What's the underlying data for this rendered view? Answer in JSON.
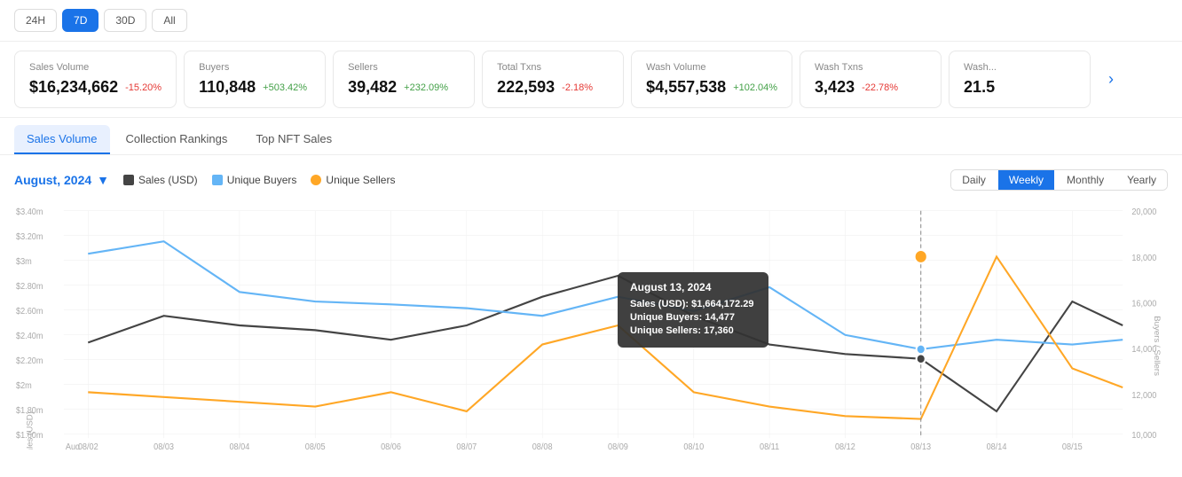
{
  "topBar": {
    "buttons": [
      {
        "label": "24H",
        "active": false
      },
      {
        "label": "7D",
        "active": true
      },
      {
        "label": "30D",
        "active": false
      },
      {
        "label": "All",
        "active": false
      }
    ]
  },
  "metrics": [
    {
      "label": "Sales Volume",
      "value": "$16,234,662",
      "change": "-15.20%",
      "changeType": "negative"
    },
    {
      "label": "Buyers",
      "value": "110,848",
      "change": "+503.42%",
      "changeType": "positive"
    },
    {
      "label": "Sellers",
      "value": "39,482",
      "change": "+232.09%",
      "changeType": "positive"
    },
    {
      "label": "Total Txns",
      "value": "222,593",
      "change": "-2.18%",
      "changeType": "negative"
    },
    {
      "label": "Wash Volume",
      "value": "$4,557,538",
      "change": "+102.04%",
      "changeType": "positive"
    },
    {
      "label": "Wash Txns",
      "value": "3,423",
      "change": "-22.78%",
      "changeType": "negative"
    },
    {
      "label": "Wash...",
      "value": "21.5",
      "change": "",
      "changeType": ""
    }
  ],
  "tabs": [
    {
      "label": "Sales Volume",
      "active": true
    },
    {
      "label": "Collection Rankings",
      "active": false
    },
    {
      "label": "Top NFT Sales",
      "active": false
    }
  ],
  "chart": {
    "monthLabel": "August, 2024",
    "legend": [
      {
        "label": "Sales (USD)",
        "color": "#444"
      },
      {
        "label": "Unique Buyers",
        "color": "#64b5f6"
      },
      {
        "label": "Unique Sellers",
        "color": "#ffa726"
      }
    ],
    "periodButtons": [
      {
        "label": "Daily",
        "active": false
      },
      {
        "label": "Weekly",
        "active": true
      },
      {
        "label": "Monthly",
        "active": false
      },
      {
        "label": "Yearly",
        "active": false
      }
    ],
    "xLabels": [
      "Aug",
      "08/02",
      "08/03",
      "08/04",
      "08/05",
      "08/06",
      "08/07",
      "08/08",
      "08/09",
      "08/10",
      "08/11",
      "08/12",
      "08/13",
      "08/14",
      "08/15"
    ],
    "yLeft": [
      "$3.40m",
      "$3.20m",
      "$3m",
      "$2.80m",
      "$2.60m",
      "$2.40m",
      "$2.20m",
      "$2m",
      "$1.80m",
      "$1.60m"
    ],
    "yRight": [
      "20,000",
      "18,000",
      "16,000",
      "14,000",
      "12,000",
      "10,000"
    ],
    "tooltip": {
      "title": "August 13, 2024",
      "rows": [
        {
          "label": "Sales (USD):",
          "value": "$1,664,172.29"
        },
        {
          "label": "Unique Buyers:",
          "value": "14,477"
        },
        {
          "label": "Unique Sellers:",
          "value": "17,360"
        }
      ]
    }
  }
}
